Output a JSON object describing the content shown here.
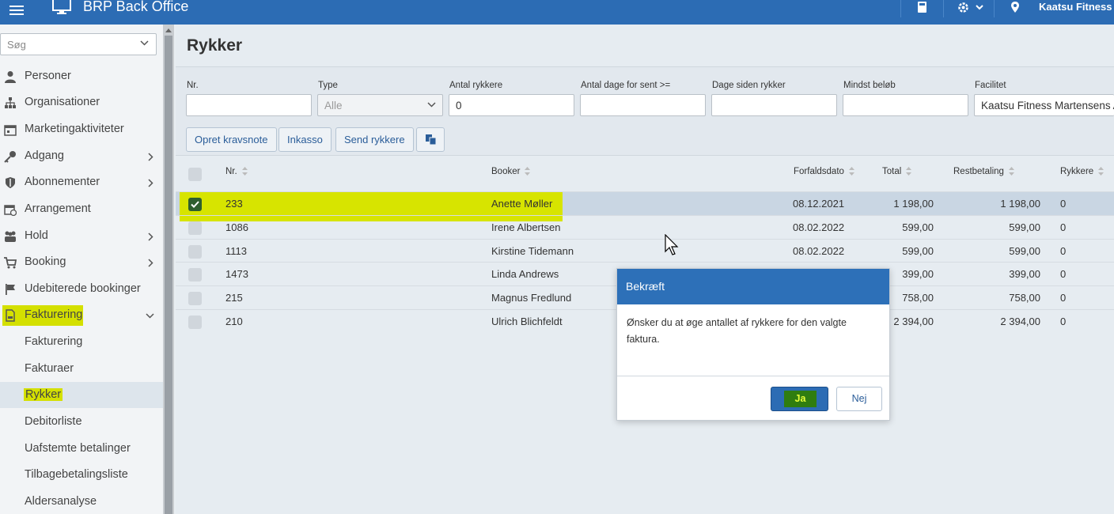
{
  "app": {
    "title": "BRP Back Office",
    "facility": "Kaatsu Fitness M"
  },
  "sidebar": {
    "search_placeholder": "Søg",
    "items": [
      {
        "label": "Personer",
        "icon": "person-icon"
      },
      {
        "label": "Organisationer",
        "icon": "org-chart-icon"
      },
      {
        "label": "Marketingaktiviteter",
        "icon": "calendar-icon"
      },
      {
        "label": "Adgang",
        "icon": "key-icon"
      },
      {
        "label": "Abonnementer",
        "icon": "shield-icon"
      },
      {
        "label": "Arrangement",
        "icon": "event-calendar-icon"
      },
      {
        "label": "Hold",
        "icon": "group-icon"
      },
      {
        "label": "Booking",
        "icon": "cart-icon"
      },
      {
        "label": "Udebiterede bookinger",
        "icon": "flag-icon"
      },
      {
        "label": "Fakturering",
        "icon": "invoice-icon"
      }
    ],
    "subitems": [
      {
        "label": "Fakturering"
      },
      {
        "label": "Fakturaer"
      },
      {
        "label": "Rykker"
      },
      {
        "label": "Debitorliste"
      },
      {
        "label": "Uafstemte betalinger"
      },
      {
        "label": "Tilbagebetalingsliste"
      },
      {
        "label": "Aldersanalyse"
      }
    ]
  },
  "page": {
    "title": "Rykker"
  },
  "filters": {
    "nr": {
      "label": "Nr.",
      "value": ""
    },
    "type": {
      "label": "Type",
      "value": "Alle"
    },
    "antal_rykkere": {
      "label": "Antal rykkere",
      "value": "0"
    },
    "antal_dage": {
      "label": "Antal dage for sent >=",
      "value": ""
    },
    "dage_siden": {
      "label": "Dage siden rykker",
      "value": ""
    },
    "mindst_beloeb": {
      "label": "Mindst beløb",
      "value": ""
    },
    "facilitet": {
      "label": "Facilitet",
      "value": "Kaatsu Fitness  Martensens A"
    }
  },
  "actions": {
    "kravsnote": "Opret kravsnote",
    "inkasso": "Inkasso",
    "send": "Send rykkere"
  },
  "table": {
    "headers": {
      "nr": "Nr.",
      "booker": "Booker",
      "forfald": "Forfaldsdato",
      "total": "Total",
      "rest": "Restbetaling",
      "rykkere": "Rykkere"
    },
    "rows": [
      {
        "nr": "233",
        "booker": "Anette Møller",
        "forfald": "08.12.2021",
        "total": "1 198,00",
        "rest": "1 198,00",
        "rykkere": "0",
        "checked": true
      },
      {
        "nr": "1086",
        "booker": "Irene Albertsen",
        "forfald": "08.02.2022",
        "total": "599,00",
        "rest": "599,00",
        "rykkere": "0",
        "checked": false
      },
      {
        "nr": "1113",
        "booker": "Kirstine Tidemann",
        "forfald": "08.02.2022",
        "total": "599,00",
        "rest": "599,00",
        "rykkere": "0",
        "checked": false
      },
      {
        "nr": "1473",
        "booker": "Linda Andrews",
        "forfald": "",
        "total": "399,00",
        "rest": "399,00",
        "rykkere": "0",
        "checked": false
      },
      {
        "nr": "215",
        "booker": "Magnus Fredlund",
        "forfald": "",
        "total": "758,00",
        "rest": "758,00",
        "rykkere": "0",
        "checked": false
      },
      {
        "nr": "210",
        "booker": "Ulrich Blichfeldt",
        "forfald": "",
        "total": "2 394,00",
        "rest": "2 394,00",
        "rykkere": "0",
        "checked": false
      }
    ]
  },
  "modal": {
    "title": "Bekræft",
    "message": "Ønsker du at øge antallet af rykkere for den valgte faktura.",
    "yes": "Ja",
    "no": "Nej"
  },
  "colors": {
    "topbar": "#2c6cb4",
    "highlight": "#d4e000",
    "primary": "#2c6cb4"
  }
}
